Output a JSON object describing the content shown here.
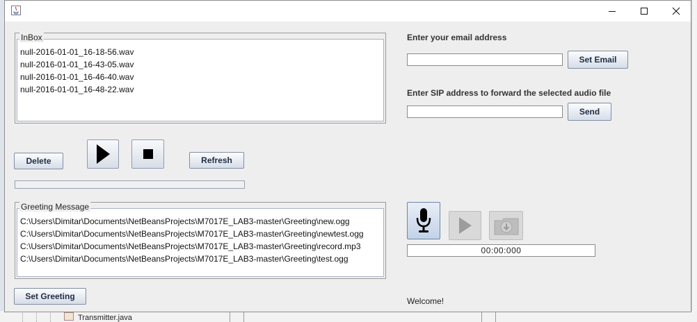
{
  "background": {
    "tree_item": "Transmitter.java"
  },
  "inbox": {
    "title": "InBox",
    "files": [
      "null-2016-01-01_16-18-56.wav",
      "null-2016-01-01_16-43-05.wav",
      "null-2016-01-01_16-46-40.wav",
      "null-2016-01-01_16-48-22.wav"
    ]
  },
  "controls": {
    "delete_label": "Delete",
    "refresh_label": "Refresh",
    "play_icon": "play-icon",
    "stop_icon": "stop-icon",
    "progress": 0
  },
  "greeting": {
    "title": "Greeting Message",
    "files": [
      "C:\\Users\\Dimitar\\Documents\\NetBeansProjects\\M7017E_LAB3-master\\Greeting\\new.ogg",
      "C:\\Users\\Dimitar\\Documents\\NetBeansProjects\\M7017E_LAB3-master\\Greeting\\newtest.ogg",
      "C:\\Users\\Dimitar\\Documents\\NetBeansProjects\\M7017E_LAB3-master\\Greeting\\record.mp3",
      "C:\\Users\\Dimitar\\Documents\\NetBeansProjects\\M7017E_LAB3-master\\Greeting\\test.ogg"
    ],
    "set_label": "Set Greeting"
  },
  "email": {
    "label": "Enter your email address",
    "value": "",
    "button": "Set Email"
  },
  "sip": {
    "label": "Enter SIP address to forward the selected audio file",
    "value": "",
    "button": "Send"
  },
  "recorder": {
    "mic_icon": "microphone-icon",
    "play_icon": "play-icon",
    "save_icon": "save-icon",
    "timer": "00:00:000"
  },
  "status": "Welcome!",
  "colors": {
    "window_bg": "#eeeeee",
    "button_text": "#1e2d44",
    "field_border": "#a9b4c4"
  }
}
